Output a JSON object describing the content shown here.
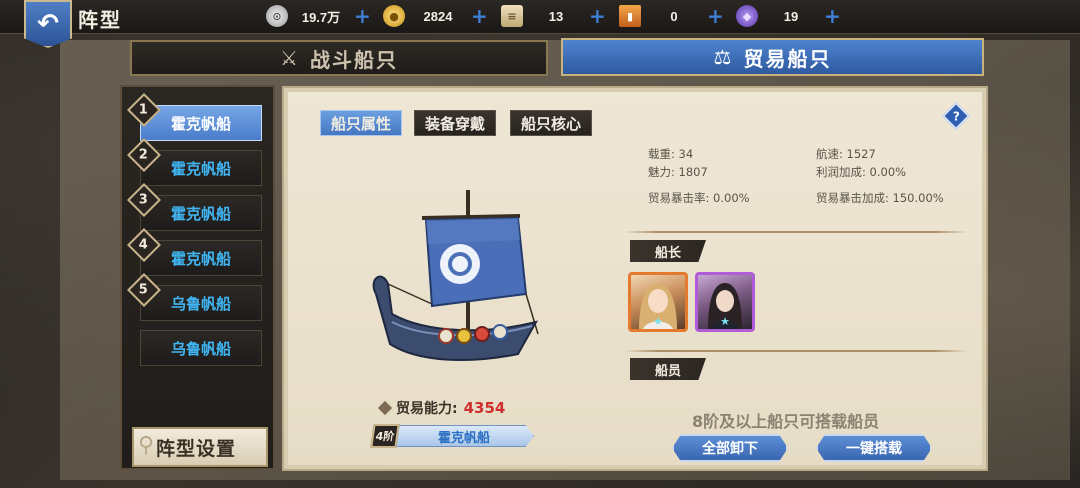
{
  "header": {
    "title": "阵型",
    "resources": [
      {
        "icon": "silver-coin-icon",
        "value": "19.7万",
        "color": "#bfbfbf"
      },
      {
        "icon": "gold-coin-icon",
        "value": "2824",
        "color": "#e7b62b"
      },
      {
        "icon": "scroll-icon",
        "value": "13",
        "color": "#d8c49a"
      },
      {
        "icon": "card-ticket-icon",
        "value": "0",
        "color": "#e28a2c"
      },
      {
        "icon": "purple-gem-icon",
        "value": "19",
        "color": "#7c5ad9"
      }
    ]
  },
  "tabs": {
    "combat": "战斗船只",
    "trade": "贸易船只"
  },
  "ship_list": {
    "items": [
      {
        "num": "1",
        "name": "霍克帆船"
      },
      {
        "num": "2",
        "name": "霍克帆船"
      },
      {
        "num": "3",
        "name": "霍克帆船"
      },
      {
        "num": "4",
        "name": "霍克帆船"
      },
      {
        "num": "5",
        "name": "乌鲁帆船"
      },
      {
        "num": "",
        "name": "乌鲁帆船"
      }
    ],
    "formation_button": "阵型设置"
  },
  "sub_tabs": [
    "船只属性",
    "装备穿戴",
    "船只核心"
  ],
  "help_label": "?",
  "stats": {
    "load": "载重: 34",
    "speed": "航速: 1527",
    "charm": "魅力: 1807",
    "profit": "利润加成: 0.00%",
    "crit_rate": "贸易暴击率: 0.00%",
    "crit_bonus": "贸易暴击加成: 150.00%"
  },
  "captain_label": "船长",
  "crew_label": "船员",
  "ability": {
    "label": "贸易能力:",
    "value": "4354"
  },
  "tier": {
    "badge": "4阶",
    "name": "霍克帆船"
  },
  "crew_note": "8阶及以上船只可搭载船员",
  "buttons": {
    "unload_all": "全部卸下",
    "auto_load": "一键搭载"
  },
  "portraits": [
    {
      "icon": "captain-portrait-blonde",
      "border": "#e37a2e",
      "star": "★"
    },
    {
      "icon": "captain-portrait-dark",
      "border": "#b05cd8",
      "star": "★"
    }
  ]
}
